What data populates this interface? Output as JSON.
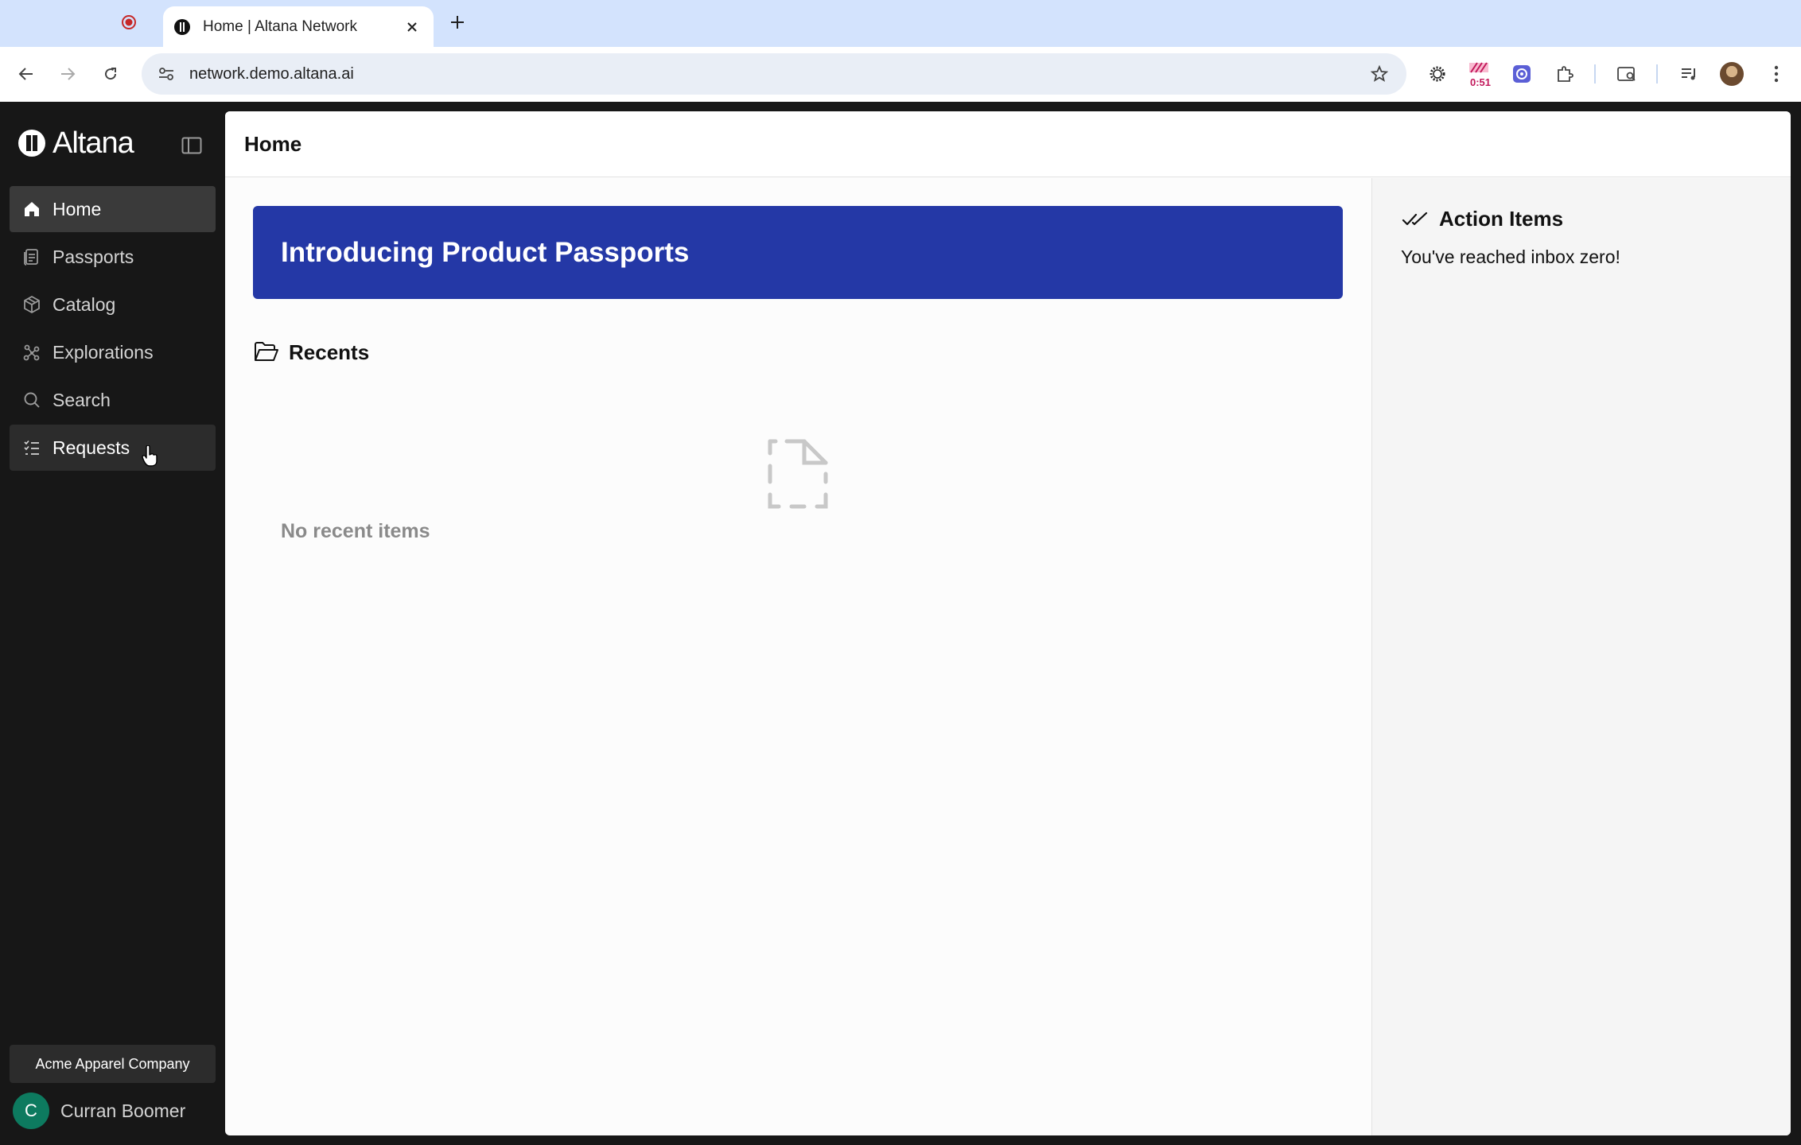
{
  "browser": {
    "tab_title": "Home | Altana Network",
    "url": "network.demo.altana.ai",
    "extension_timer": "0:51"
  },
  "sidebar": {
    "logo_text": "Altana",
    "items": [
      {
        "label": "Home",
        "icon": "home-icon"
      },
      {
        "label": "Passports",
        "icon": "passport-icon"
      },
      {
        "label": "Catalog",
        "icon": "box-icon"
      },
      {
        "label": "Explorations",
        "icon": "graph-icon"
      },
      {
        "label": "Search",
        "icon": "search-icon"
      },
      {
        "label": "Requests",
        "icon": "checklist-icon"
      }
    ],
    "organization": "Acme Apparel Company",
    "user_initial": "C",
    "user_name": "Curran Boomer"
  },
  "main": {
    "page_title": "Home",
    "banner_title": "Introducing Product Passports",
    "recents_heading": "Recents",
    "recents_empty": "No recent items"
  },
  "action_items": {
    "heading": "Action Items",
    "empty_message": "You've reached inbox zero!"
  },
  "colors": {
    "banner": "#2438a6",
    "sidebar": "#171717",
    "user_avatar": "#0d7a5f"
  }
}
